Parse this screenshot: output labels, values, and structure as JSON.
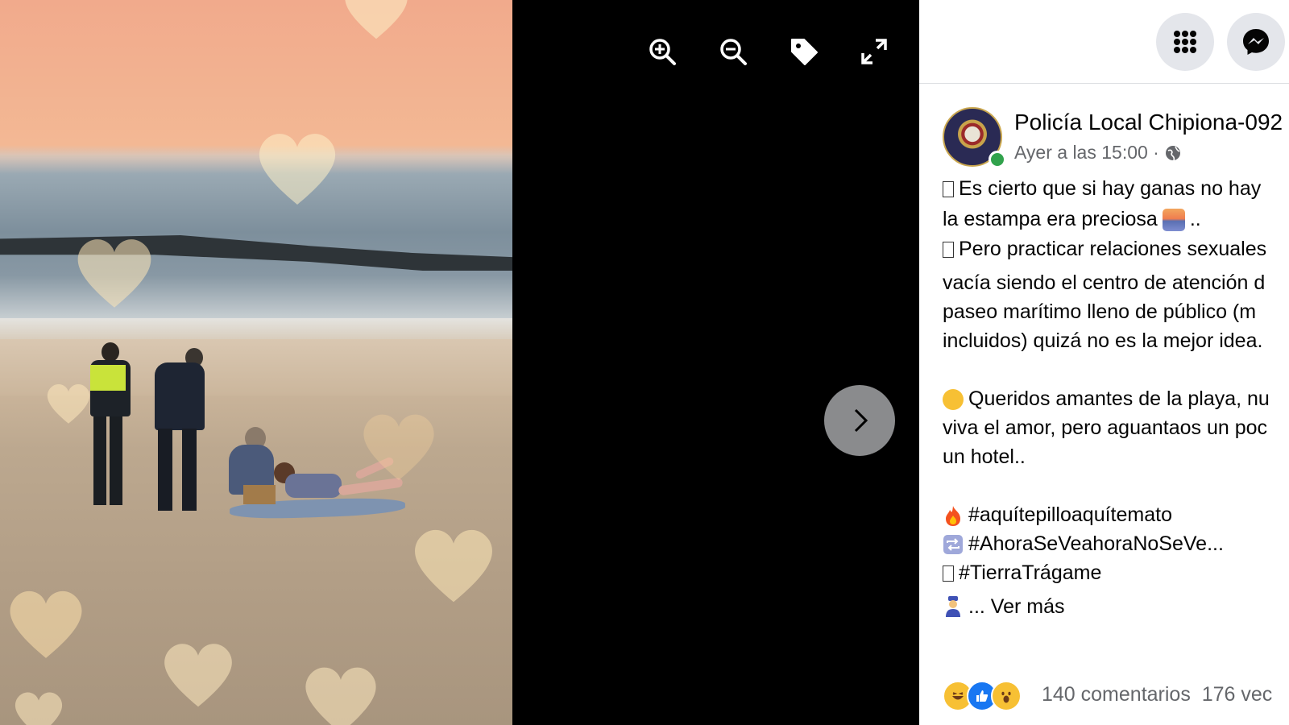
{
  "viewer": {
    "toolbar": [
      {
        "name": "zoom-in-icon"
      },
      {
        "name": "zoom-out-icon"
      },
      {
        "name": "tag-icon"
      },
      {
        "name": "fullscreen-icon"
      }
    ],
    "next_icon": "chevron-right-icon"
  },
  "header": {
    "menu_icon": "grid-menu-icon",
    "messenger_icon": "messenger-icon"
  },
  "post": {
    "author": "Policía Local Chipiona-092",
    "timestamp": "Ayer a las 15:00 ·",
    "privacy_icon": "globe-icon",
    "lines": [
      "Es cierto que si hay ganas no hay",
      "la estampa era preciosa",
      "..",
      "Pero practicar relaciones sexuales",
      "vacía siendo el centro de atención d",
      "paseo marítimo lleno de público (m",
      "incluidos) quizá no es la mejor idea.",
      "Queridos amantes de la playa, nu",
      "viva el amor, pero aguantaos un poc",
      "un hotel.."
    ],
    "hashtags": [
      "#aquítepilloaquítemato",
      "#AhoraSeVeahoraNoSeVe...",
      "#TierraTrágame"
    ],
    "see_more": "... Ver más",
    "comments": "140 comentarios",
    "shares": "176 vec"
  },
  "colors": {
    "panel_bg": "#ffffff",
    "text": "#050505",
    "muted": "#65676b",
    "online": "#31a24c",
    "button_bg": "#e4e6eb"
  }
}
